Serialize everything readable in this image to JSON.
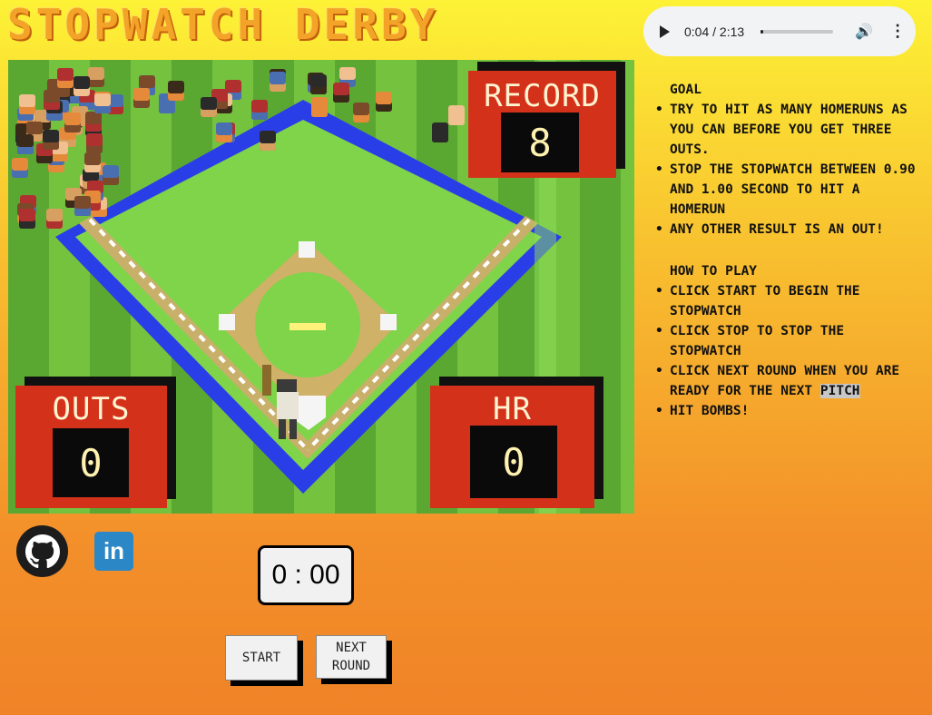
{
  "game": {
    "title": "STOPWATCH DERBY"
  },
  "audio": {
    "time": "0:04 / 2:13",
    "progress": 0.03
  },
  "scoreboards": {
    "record": {
      "label": "RECORD",
      "value": "8"
    },
    "outs": {
      "label": "OUTS",
      "value": "0"
    },
    "hr": {
      "label": "HR",
      "value": "0"
    }
  },
  "instructions": {
    "goal_heading": "GOAL",
    "goal_items": [
      "TRY TO HIT AS MANY HOMERUNS AS YOU CAN BEFORE YOU GET THREE OUTS.",
      "STOP THE STOPWATCH BETWEEN 0.90 AND 1.00 SECOND TO HIT A HOMERUN",
      "ANY OTHER RESULT IS AN OUT!"
    ],
    "howto_heading": "HOW TO PLAY",
    "howto_items": [
      "CLICK START TO BEGIN THE STOPWATCH",
      "CLICK STOP TO STOP THE STOPWATCH",
      "CLICK NEXT ROUND WHEN YOU ARE READY FOR THE NEXT",
      "HIT BOMBS!"
    ],
    "howto_highlight": "PITCH"
  },
  "socials": {
    "github_icon": "github-icon",
    "linkedin_label": "in"
  },
  "stopwatch": {
    "display": "0 : 00"
  },
  "controls": {
    "start_label": "START",
    "next_round_label": "NEXT ROUND"
  }
}
